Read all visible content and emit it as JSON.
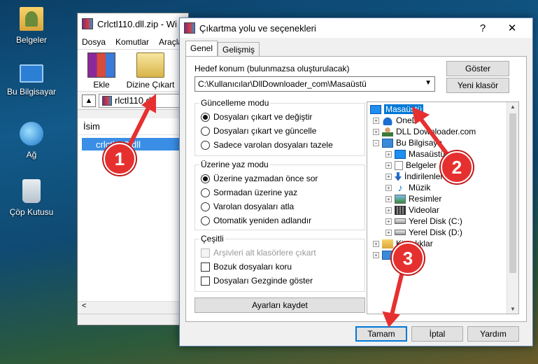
{
  "desktop": {
    "icons": [
      {
        "label": "Belgeler",
        "icon": "user-folder-icon"
      },
      {
        "label": "Bu Bilgisayar",
        "icon": "computer-icon"
      },
      {
        "label": "Ağ",
        "icon": "network-icon"
      },
      {
        "label": "Çöp Kutusu",
        "icon": "recycle-bin-icon"
      }
    ]
  },
  "rar": {
    "title": "Crlctl110.dll.zip - Wi",
    "menu": [
      "Dosya",
      "Komutlar",
      "Araçla"
    ],
    "tools": {
      "add": "Ekle",
      "extract": "Dizine Çıkart"
    },
    "path": "rlctl110.dll",
    "column": "İsim",
    "file": "crlctl110.dll"
  },
  "dialog": {
    "title": "Çıkartma yolu ve seçenekleri",
    "help": "?",
    "close": "✕",
    "tabs": [
      "Genel",
      "Gelişmiş"
    ],
    "dest_label": "Hedef konum (bulunmazsa oluşturulacak)",
    "dest_value": "C:\\Kullanıcılar\\DllDownloader_com\\Masaüstü",
    "show_btn": "Göster",
    "new_folder_btn": "Yeni klasör",
    "update_group": {
      "title": "Güncelleme modu",
      "options": [
        "Dosyaları çıkart ve değiştir",
        "Dosyaları çıkart ve güncelle",
        "Sadece varolan dosyaları tazele"
      ],
      "selected": 0
    },
    "overwrite_group": {
      "title": "Üzerine yaz modu",
      "options": [
        "Üzerine yazmadan önce sor",
        "Sormadan üzerine yaz",
        "Varolan dosyaları atla",
        "Otomatik yeniden adlandır"
      ],
      "selected": 0
    },
    "misc_group": {
      "title": "Çeşitli",
      "options": [
        "Arşivleri alt klasörlere çıkart",
        "Bozuk dosyaları koru",
        "Dosyaları Gezginde göster"
      ]
    },
    "save_btn": "Ayarları kaydet",
    "tree": [
      {
        "label": "Masaüstü",
        "icon": "desktop-icon",
        "selected": true
      },
      {
        "label": "OneD",
        "icon": "onedrive-icon"
      },
      {
        "label": "DLL Downloader.com",
        "icon": "user-icon"
      },
      {
        "label": "Bu Bilgisaya",
        "icon": "computer-icon"
      },
      {
        "label": "Masaüstü",
        "icon": "desktop-icon"
      },
      {
        "label": "Belgeler",
        "icon": "document-icon"
      },
      {
        "label": "İndirilenler",
        "icon": "download-icon"
      },
      {
        "label": "Müzik",
        "icon": "music-icon"
      },
      {
        "label": "Resimler",
        "icon": "pictures-icon"
      },
      {
        "label": "Videolar",
        "icon": "video-icon"
      },
      {
        "label": "Yerel Disk (C:)",
        "icon": "disk-icon"
      },
      {
        "label": "Yerel Disk (D:)",
        "icon": "disk-icon"
      },
      {
        "label": "Kitaplıklar",
        "icon": "library-icon"
      },
      {
        "label": "",
        "icon": "network-icon"
      }
    ],
    "ok_btn": "Tamam",
    "cancel_btn": "İptal",
    "help_btn": "Yardım"
  },
  "callouts": [
    "1",
    "2",
    "3"
  ]
}
